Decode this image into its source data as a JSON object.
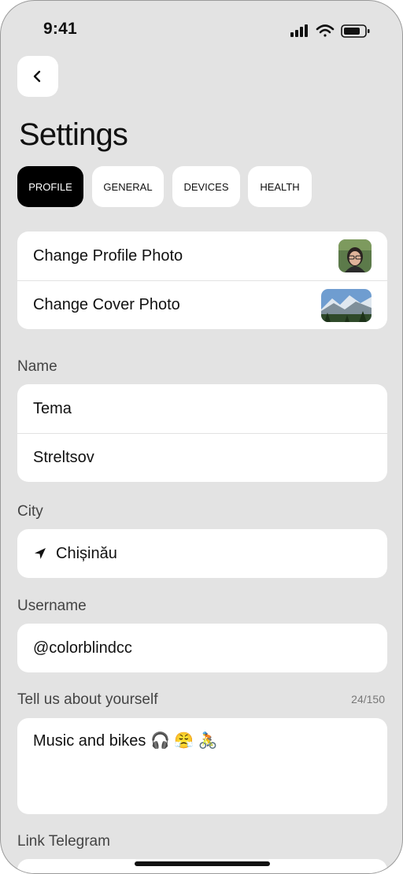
{
  "status_bar": {
    "time": "9:41",
    "icons": [
      "signal-icon",
      "wifi-icon",
      "battery-icon"
    ]
  },
  "header": {
    "back_icon": "chevron-left-icon",
    "title": "Settings"
  },
  "tabs": [
    {
      "label": "PROFILE",
      "active": true
    },
    {
      "label": "GENERAL",
      "active": false
    },
    {
      "label": "DEVICES",
      "active": false
    },
    {
      "label": "HEALTH",
      "active": false
    }
  ],
  "photos": {
    "profile_label": "Change Profile Photo",
    "cover_label": "Change Cover Photo"
  },
  "name": {
    "label": "Name",
    "first": "Tema",
    "last": "Streltsov"
  },
  "city": {
    "label": "City",
    "icon": "location-arrow-icon",
    "value": "Chișinău"
  },
  "username": {
    "label": "Username",
    "value": "@colorblindcc"
  },
  "bio": {
    "label": "Tell us about yourself",
    "counter": "24/150",
    "value": "Music and bikes 🎧 😤 🚴"
  },
  "telegram": {
    "label": "Link Telegram"
  },
  "colors": {
    "background": "#e3e3e3",
    "card": "#ffffff",
    "active_tab": "#000000",
    "text": "#111111",
    "muted": "#444444"
  }
}
